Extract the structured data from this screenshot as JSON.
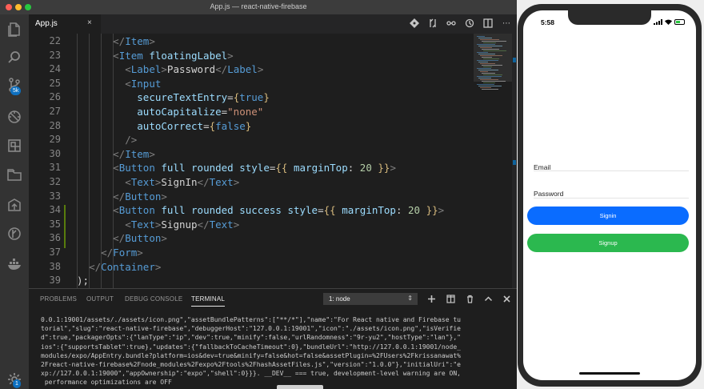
{
  "window": {
    "title": "App.js — react-native-firebase"
  },
  "activity_bar": {
    "items": [
      {
        "name": "explorer-icon"
      },
      {
        "name": "search-icon"
      },
      {
        "name": "source-control-icon",
        "badge": "5k"
      },
      {
        "name": "debug-icon"
      },
      {
        "name": "extensions-icon"
      },
      {
        "name": "folder-icon"
      },
      {
        "name": "deploy-icon"
      },
      {
        "name": "git-lens-icon"
      },
      {
        "name": "docker-icon"
      }
    ],
    "settings_badge": "1"
  },
  "editor": {
    "tab_label": "App.js",
    "tab_close": "×",
    "lines": [
      {
        "n": "22",
        "text": "      </Item>"
      },
      {
        "n": "23",
        "text": "      <Item floatingLabel>"
      },
      {
        "n": "24",
        "text": "        <Label>Password</Label>"
      },
      {
        "n": "25",
        "text": "        <Input"
      },
      {
        "n": "26",
        "text": "          secureTextEntry={true}"
      },
      {
        "n": "27",
        "text": "          autoCapitalize=\"none\""
      },
      {
        "n": "28",
        "text": "          autoCorrect={false}"
      },
      {
        "n": "29",
        "text": "        />"
      },
      {
        "n": "30",
        "text": "      </Item>"
      },
      {
        "n": "31",
        "text": "      <Button full rounded style={{ marginTop: 20 }}>"
      },
      {
        "n": "32",
        "text": "        <Text>SignIn</Text>"
      },
      {
        "n": "33",
        "text": "      </Button>"
      },
      {
        "n": "34",
        "text": "      <Button full rounded success style={{ marginTop: 20 }}>"
      },
      {
        "n": "35",
        "text": "        <Text>Signup</Text>"
      },
      {
        "n": "36",
        "text": "      </Button>"
      },
      {
        "n": "37",
        "text": "    </Form>"
      },
      {
        "n": "38",
        "text": "  </Container>"
      },
      {
        "n": "39",
        "text": ");"
      }
    ]
  },
  "panel": {
    "tabs": [
      "PROBLEMS",
      "OUTPUT",
      "DEBUG CONSOLE",
      "TERMINAL"
    ],
    "active_tab": "TERMINAL",
    "terminal_select": "1: node",
    "terminal_lines": [
      "0.0.1:19001/assets/./assets/icon.png\",\"assetBundlePatterns\":[\"**/*\"],\"name\":\"For React native and Firebase tu",
      "torial\",\"slug\":\"react-native-firebase\",\"debuggerHost\":\"127.0.0.1:19001\",\"icon\":\"./assets/icon.png\",\"isVerifie",
      "d\":true,\"packagerOpts\":{\"lanType\":\"ip\",\"dev\":true,\"minify\":false,\"urlRandomness\":\"9r-yu2\",\"hostType\":\"lan\"},\"",
      "ios\":{\"supportsTablet\":true},\"updates\":{\"fallbackToCacheTimeout\":0},\"bundleUrl\":\"http://127.0.0.1:19001/node_",
      "modules/expo/AppEntry.bundle?platform=ios&dev=true&minify=false&hot=false&assetPlugin=%2FUsers%2Fkrissanawat%",
      "2Freact-native-firebase%2Fnode_modules%2Fexpo%2Ftools%2FhashAssetFiles.js\",\"version\":\"1.0.0\"},\"initialUri\":\"e",
      "xp://127.0.0.1:19000\",\"appOwnership\":\"expo\",\"shell\":0}}}. __DEV__ === true, development-level warning are ON,",
      " performance optimizations are OFF"
    ]
  },
  "simulator": {
    "time": "5:58",
    "email_label": "Email",
    "password_label": "Password",
    "signin_label": "Signin",
    "signup_label": "Signup",
    "colors": {
      "signin": "#0a6cff",
      "signup": "#2bb84f"
    }
  },
  "syntax_colors": {
    "tag": "#569cd6",
    "attr": "#9cdcfe",
    "string": "#ce9178",
    "brace": "#d7ba7d",
    "number": "#b5cea8",
    "bracket": "#808080",
    "text": "#d4d4d4"
  }
}
